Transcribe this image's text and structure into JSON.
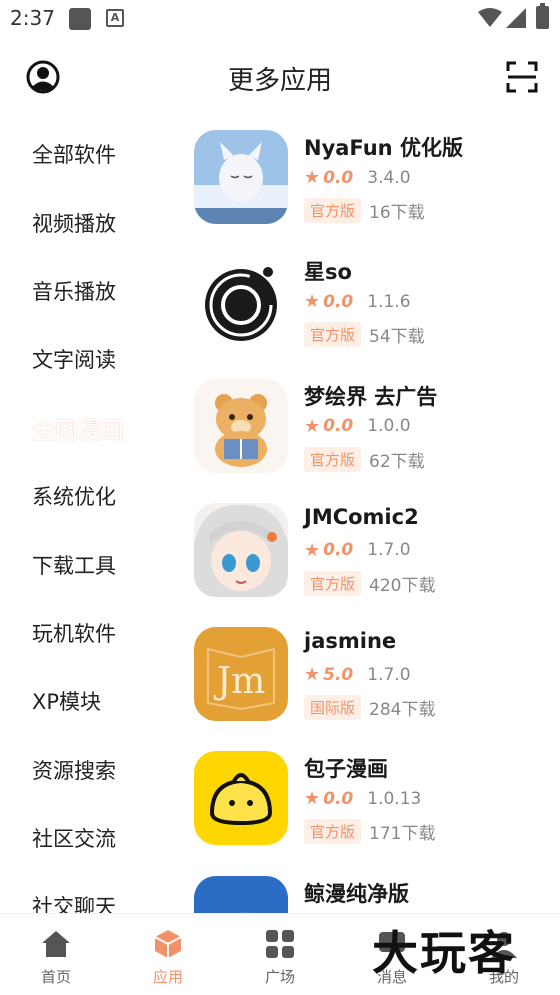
{
  "status_bar": {
    "time": "2:37"
  },
  "header": {
    "title": "更多应用"
  },
  "sidebar": {
    "items": [
      {
        "label": "全部软件"
      },
      {
        "label": "视频播放"
      },
      {
        "label": "音乐播放"
      },
      {
        "label": "文字阅读"
      },
      {
        "label": "全网漫画",
        "active": true
      },
      {
        "label": "系统优化"
      },
      {
        "label": "下载工具"
      },
      {
        "label": "玩机软件"
      },
      {
        "label": "XP模块"
      },
      {
        "label": "资源搜索"
      },
      {
        "label": "社区交流"
      },
      {
        "label": "社交聊天"
      }
    ]
  },
  "apps": [
    {
      "name": "NyaFun 优化版",
      "score": "0.0",
      "version": "3.4.0",
      "badge": "官方版",
      "downloads": "16下载"
    },
    {
      "name": "星so",
      "score": "0.0",
      "version": "1.1.6",
      "badge": "官方版",
      "downloads": "54下载"
    },
    {
      "name": "梦绘界 去广告",
      "score": "0.0",
      "version": "1.0.0",
      "badge": "官方版",
      "downloads": "62下载"
    },
    {
      "name": "JMComic2",
      "score": "0.0",
      "version": "1.7.0",
      "badge": "官方版",
      "downloads": "420下载"
    },
    {
      "name": "jasmine",
      "score": "5.0",
      "version": "1.7.0",
      "badge": "国际版",
      "downloads": "284下载",
      "icon_text": "Jm"
    },
    {
      "name": "包子漫画",
      "score": "0.0",
      "version": "1.0.13",
      "badge": "官方版",
      "downloads": "171下载"
    },
    {
      "name": "鲸漫纯净版"
    }
  ],
  "bottom_nav": {
    "items": [
      {
        "label": "首页"
      },
      {
        "label": "应用",
        "active": true
      },
      {
        "label": "广场"
      },
      {
        "label": "消息"
      },
      {
        "label": "我的"
      }
    ]
  },
  "watermark": "大玩客",
  "colors": {
    "accent": "#f39268",
    "active_bg": "#fde0d0",
    "badge_bg": "#fdeee6"
  }
}
